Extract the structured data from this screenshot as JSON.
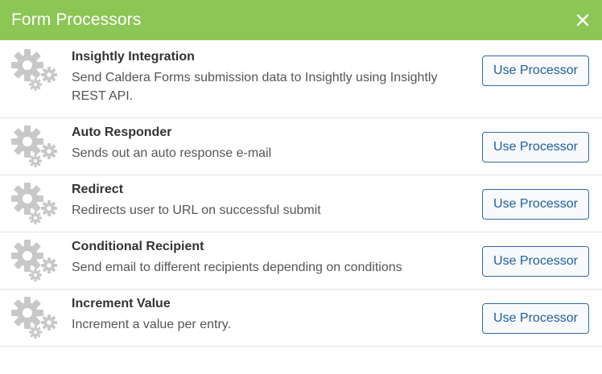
{
  "header": {
    "title": "Form Processors",
    "close_icon": "close-icon",
    "background": "#8cc655"
  },
  "processors": [
    {
      "name": "Insightly Integration",
      "description": "Send Caldera Forms submission data to Insightly using Insightly REST API.",
      "button_label": "Use Processor",
      "icon": "gears-icon"
    },
    {
      "name": "Auto Responder",
      "description": "Sends out an auto response e-mail",
      "button_label": "Use Processor",
      "icon": "gears-icon"
    },
    {
      "name": "Redirect",
      "description": "Redirects user to URL on successful submit",
      "button_label": "Use Processor",
      "icon": "gears-icon"
    },
    {
      "name": "Conditional Recipient",
      "description": "Send email to different recipients depending on conditions",
      "button_label": "Use Processor",
      "icon": "gears-icon"
    },
    {
      "name": "Increment Value",
      "description": "Increment a value per entry.",
      "button_label": "Use Processor",
      "icon": "gears-icon"
    }
  ]
}
